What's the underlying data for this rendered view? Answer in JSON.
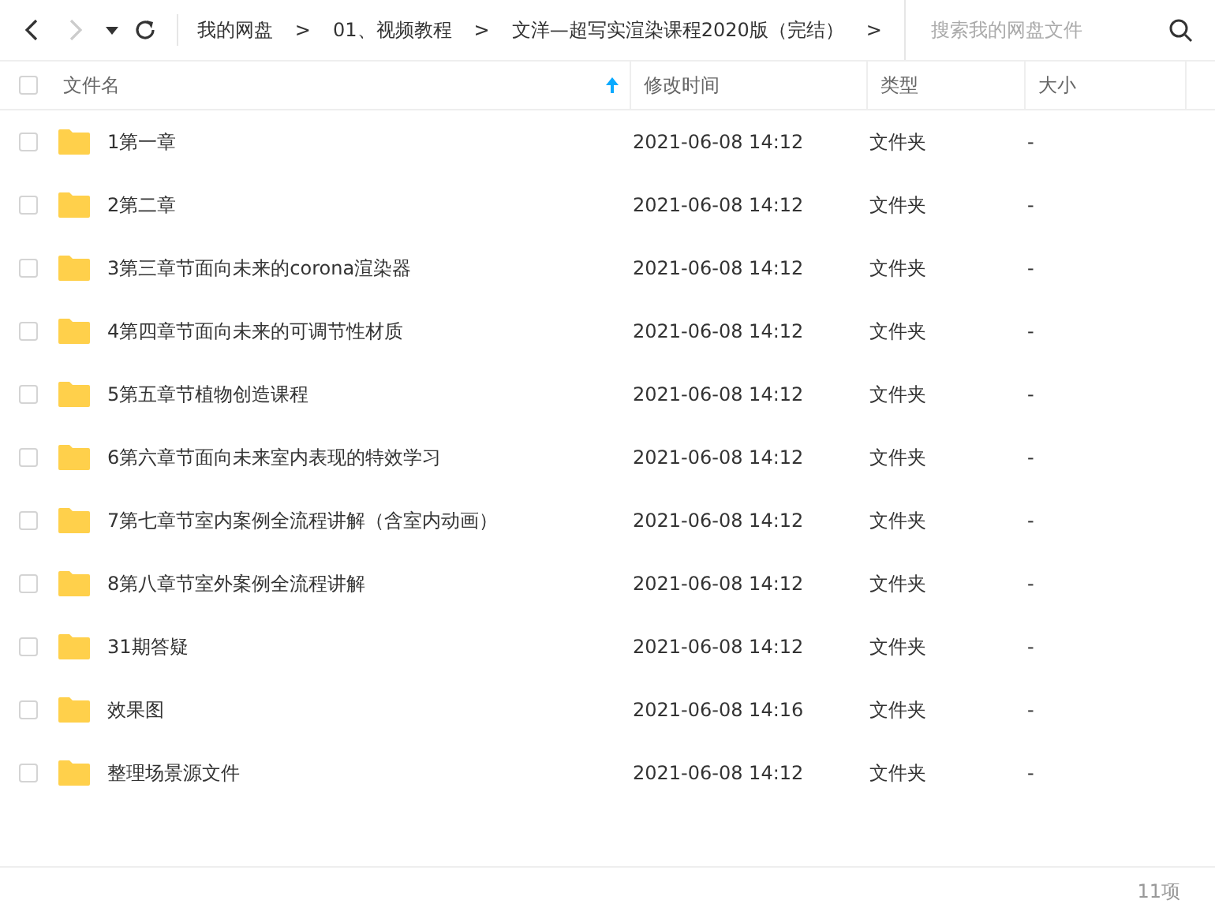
{
  "nav": {
    "back_disabled": false,
    "forward_disabled": true
  },
  "breadcrumbs": [
    {
      "label": "我的网盘",
      "separator": ">"
    },
    {
      "label": "01、视频教程",
      "separator": ">"
    },
    {
      "label": "文洋—超写实渲染课程2020版（完结）",
      "separator": ">"
    }
  ],
  "search": {
    "placeholder": "搜索我的网盘文件"
  },
  "table": {
    "select_all": {
      "checked": false
    },
    "columns": [
      {
        "label": "文件名",
        "sorted_ascending": true
      },
      {
        "label": "修改时间",
        "sorted_ascending": false
      },
      {
        "label": "类型",
        "sorted_ascending": false
      },
      {
        "label": "大小",
        "sorted_ascending": false
      }
    ],
    "rows": [
      {
        "checked": false,
        "kind": "folder",
        "name": "1第一章",
        "modified": "2021-06-08 14:12",
        "type": "文件夹",
        "size": "-"
      },
      {
        "checked": false,
        "kind": "folder",
        "name": "2第二章",
        "modified": "2021-06-08 14:12",
        "type": "文件夹",
        "size": "-"
      },
      {
        "checked": false,
        "kind": "folder",
        "name": "3第三章节面向未来的corona渲染器",
        "modified": "2021-06-08 14:12",
        "type": "文件夹",
        "size": "-"
      },
      {
        "checked": false,
        "kind": "folder",
        "name": "4第四章节面向未来的可调节性材质",
        "modified": "2021-06-08 14:12",
        "type": "文件夹",
        "size": "-"
      },
      {
        "checked": false,
        "kind": "folder",
        "name": "5第五章节植物创造课程",
        "modified": "2021-06-08 14:12",
        "type": "文件夹",
        "size": "-"
      },
      {
        "checked": false,
        "kind": "folder",
        "name": "6第六章节面向未来室内表现的特效学习",
        "modified": "2021-06-08 14:12",
        "type": "文件夹",
        "size": "-"
      },
      {
        "checked": false,
        "kind": "folder",
        "name": "7第七章节室内案例全流程讲解（含室内动画）",
        "modified": "2021-06-08 14:12",
        "type": "文件夹",
        "size": "-"
      },
      {
        "checked": false,
        "kind": "folder",
        "name": "8第八章节室外案例全流程讲解",
        "modified": "2021-06-08 14:12",
        "type": "文件夹",
        "size": "-"
      },
      {
        "checked": false,
        "kind": "folder",
        "name": "31期答疑",
        "modified": "2021-06-08 14:12",
        "type": "文件夹",
        "size": "-"
      },
      {
        "checked": false,
        "kind": "folder",
        "name": "效果图",
        "modified": "2021-06-08 14:16",
        "type": "文件夹",
        "size": "-"
      },
      {
        "checked": false,
        "kind": "folder",
        "name": "整理场景源文件",
        "modified": "2021-06-08 14:12",
        "type": "文件夹",
        "size": "-"
      }
    ]
  },
  "status_bar": {
    "count": "11项"
  }
}
